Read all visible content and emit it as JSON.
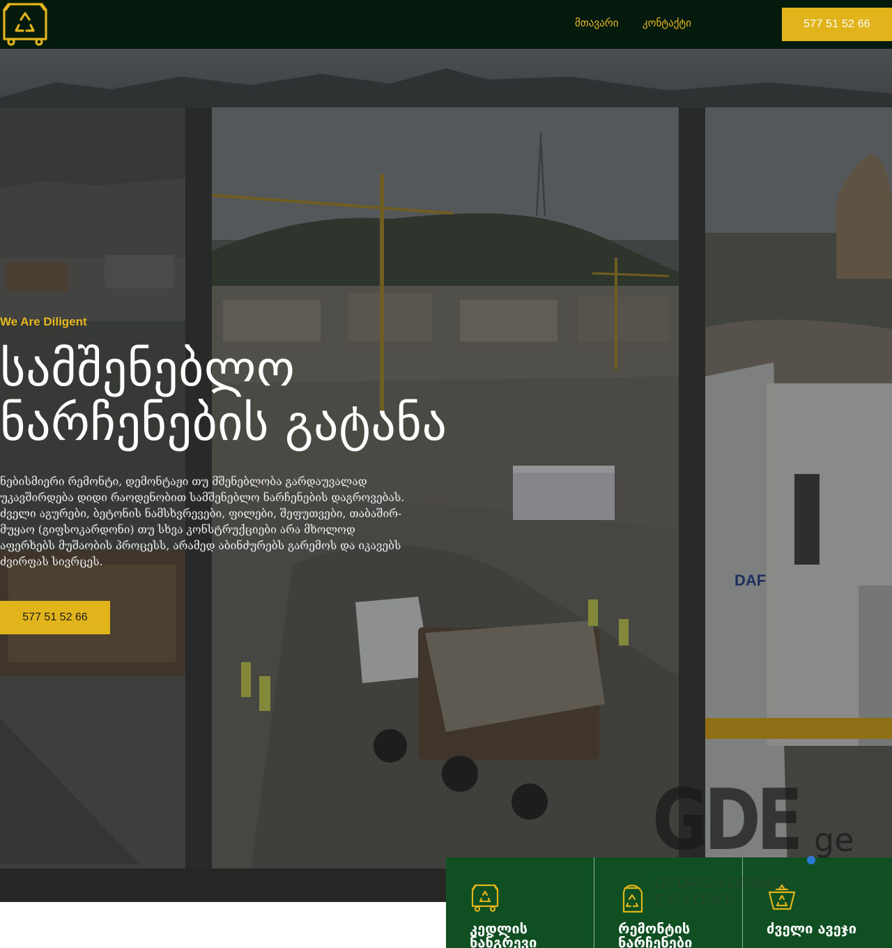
{
  "header": {
    "logo_icon": "recycling-container-icon",
    "nav": [
      {
        "label": "მთავარი"
      },
      {
        "label": "კონტაქტი"
      }
    ],
    "phone_button": "577 51 52 66"
  },
  "hero": {
    "tagline": "We Are Diligent",
    "title_line1": "სამშენებლო",
    "title_line2": "ნარჩენების გატანა",
    "description": "ნებისმიერი რემონტი, დემონტაჟი თუ მშენებლობა გარდაუვალად უკავშირდება დიდი რაოდენობით სამშენებლო ნარჩენების დაგროვებას. ძველი აგურები, ბეტონის ნამსხვრევები, ფილები, შეფუთვები, თაბაშირ-მუყაო (გიფსოკარდონი) თუ სხვა კონსტრუქციები არა მხოლოდ აფერხებს მუშაობის პროცესს, არამედ აბინძურებს გარემოს და იკავებს ძვირფას სივრცეს.",
    "phone_button": "577 51 52 66",
    "background_icon": "construction-site-image"
  },
  "watermark": {
    "main": "GDE",
    "tld": "ge",
    "subtitle": "GEORGIA DOMAIN EXPLORER"
  },
  "services": [
    {
      "label": "კედლის ნანგრევი",
      "icon": "recycling-container-icon"
    },
    {
      "label": "რემონტის ნარჩენები",
      "icon": "recycling-bin-icon"
    },
    {
      "label": "ძველი ავეჯი",
      "icon": "recycling-basket-icon"
    }
  ],
  "colors": {
    "header_bg": "#041a0c",
    "accent": "#e2b41b",
    "services_bg": "#0f4f22"
  }
}
